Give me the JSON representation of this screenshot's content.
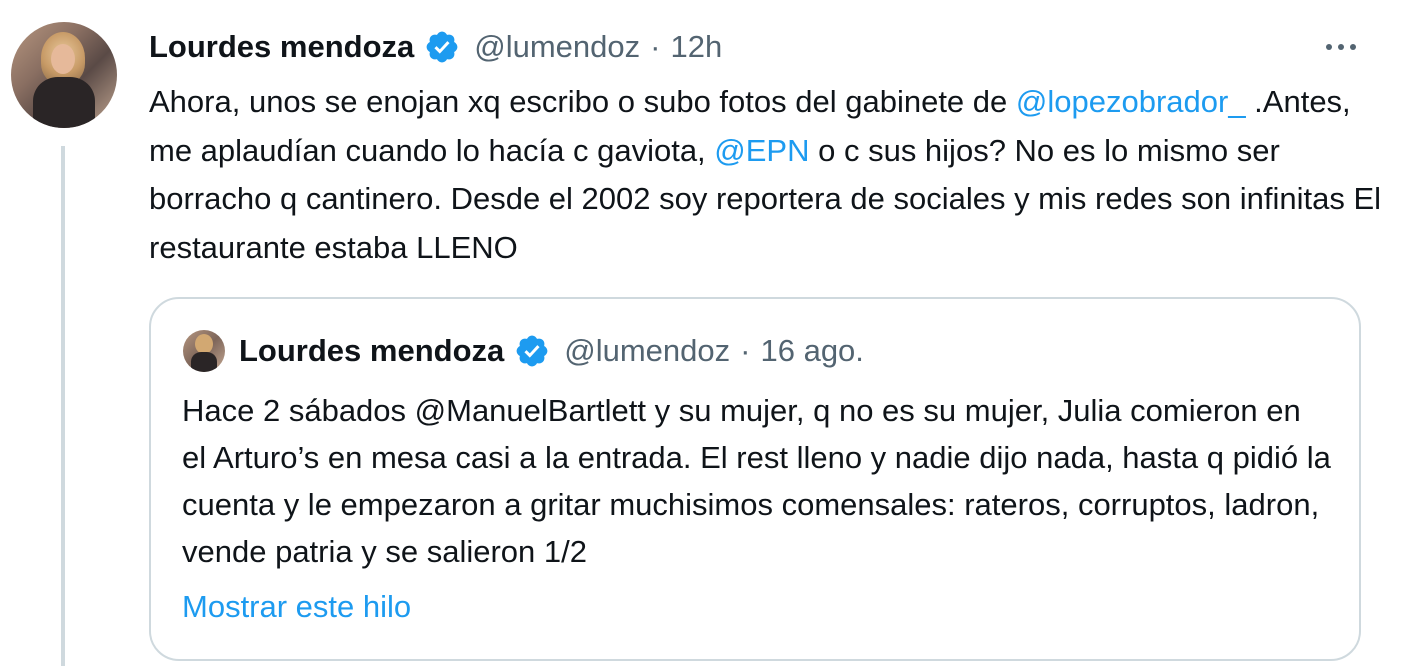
{
  "tweet": {
    "author_name": "Lourdes mendoza",
    "handle": "@lumendoz",
    "separator": "·",
    "time": "12h",
    "text_parts": {
      "p1": "Ahora, unos se enojan xq escribo o subo fotos del gabinete de ",
      "m1": "@lopezobrador_",
      "p2": " .Antes, me aplaudían  cuando lo hacía c gaviota, ",
      "m2": "@EPN",
      "p3": " o c sus hijos? No es lo mismo ser borracho q cantinero. Desde el 2002 soy reportera de sociales y mis redes son infinitas El restaurante estaba LLENO"
    }
  },
  "quoted_tweet": {
    "author_name": "Lourdes mendoza",
    "handle": "@lumendoz",
    "separator": "·",
    "time": "16 ago.",
    "text": "Hace 2 sábados @ManuelBartlett y su mujer, q no es su mujer, Julia comieron en el Arturo’s en mesa casi a la entrada. El rest lleno y nadie dijo nada, hasta q pidió la cuenta y le empezaron a gritar muchisimos comensales: rateros, corruptos, ladron, vende patria y se salieron 1/2",
    "show_thread_label": "Mostrar este hilo"
  },
  "icons": {
    "verified": "verified-badge-icon",
    "more": "more-options-icon"
  },
  "colors": {
    "accent": "#1d9bf0",
    "text": "#0f1419",
    "secondary": "#536471",
    "border": "#cfd9de"
  }
}
